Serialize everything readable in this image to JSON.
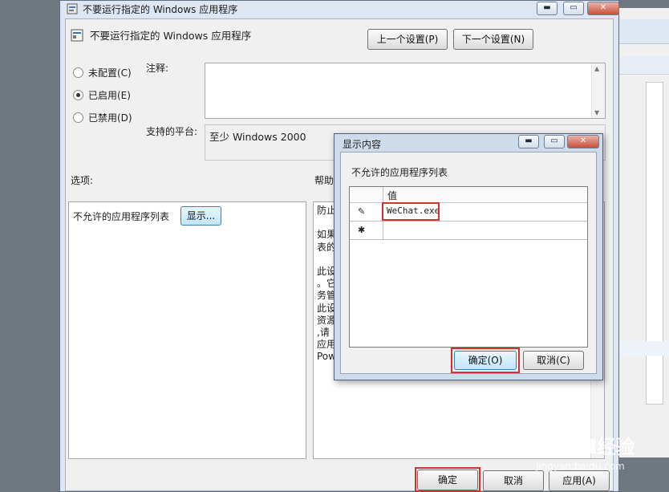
{
  "main_window": {
    "title": "不要运行指定的 Windows 应用程序",
    "setting_title": "不要运行指定的 Windows 应用程序",
    "prev_button": "上一个设置(P)",
    "next_button": "下一个设置(N)",
    "radio_options": [
      {
        "label": "未配置(C)",
        "selected": false
      },
      {
        "label": "已启用(E)",
        "selected": true
      },
      {
        "label": "已禁用(D)",
        "selected": false
      }
    ],
    "comment_label": "注释:",
    "platform_label": "支持的平台:",
    "platform_value": "至少 Windows 2000",
    "options_label": "选项:",
    "help_label": "帮助",
    "options_item_label": "不允许的应用程序列表",
    "show_button": "显示...",
    "help_lines": [
      "防止",
      "",
      "如果",
      "表的",
      "",
      "此设",
      "。它",
      "务管",
      "此设",
      "资源",
      ",请",
      "应用",
      "Pow"
    ],
    "ok_button": "确定",
    "cancel_button": "取消",
    "apply_button": "应用(A)"
  },
  "dialog": {
    "title": "显示内容",
    "list_caption": "不允许的应用程序列表",
    "column_header": "值",
    "rows": [
      {
        "marker": "✎",
        "value": "WeChat.exe"
      },
      {
        "marker": "✱",
        "value": ""
      }
    ],
    "ok_button": "确定(O)",
    "cancel_button": "取消(C)"
  },
  "watermark": {
    "brand": "Baidu",
    "brand_suffix": "经验",
    "url": "jingyan.baidu.com"
  },
  "colors": {
    "highlight": "#d92e2e",
    "title_frame": "#dde6f1",
    "close_button": "#c8503a"
  }
}
